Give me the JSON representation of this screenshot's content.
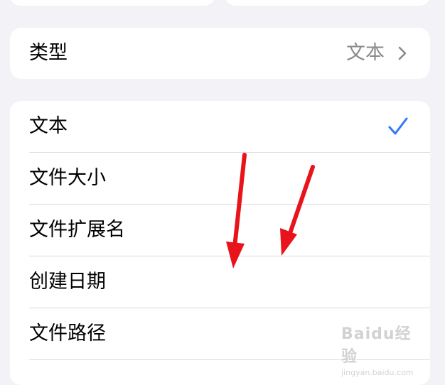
{
  "type_row": {
    "label": "类型",
    "value": "文本"
  },
  "options": [
    {
      "label": "文本",
      "selected": true
    },
    {
      "label": "文件大小",
      "selected": false
    },
    {
      "label": "文件扩展名",
      "selected": false
    },
    {
      "label": "创建日期",
      "selected": false
    },
    {
      "label": "文件路径",
      "selected": false
    }
  ],
  "colors": {
    "background": "#f2f2f7",
    "card": "#ffffff",
    "check": "#3478f6",
    "secondary_text": "#8a8a8e",
    "annotation_arrow": "#e8141b"
  },
  "icons": {
    "disclosure": "chevron-right-icon",
    "selected": "checkmark-icon"
  },
  "watermark": {
    "logo": "Baidu经验",
    "url": "jingyan.baidu.com"
  }
}
